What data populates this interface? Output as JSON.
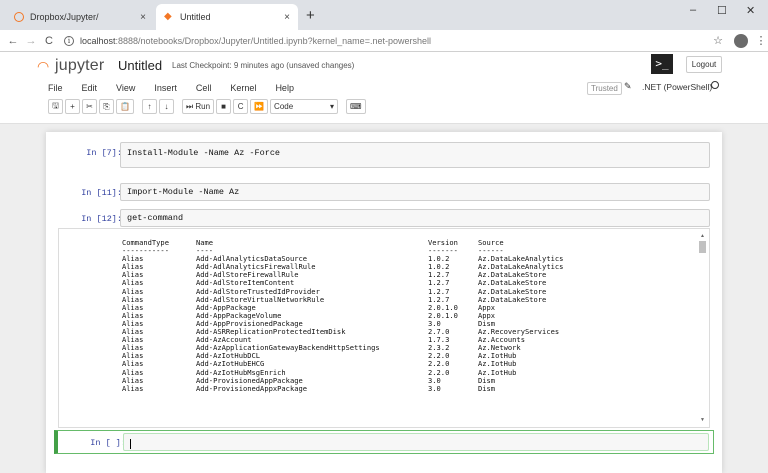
{
  "browser": {
    "tabs": [
      {
        "title": "Dropbox/Jupyter/",
        "close": "×"
      },
      {
        "title": "Untitled",
        "close": "×"
      }
    ],
    "new_tab": "+",
    "window_controls": {
      "minimize": "–",
      "maximize": "☐",
      "close": "✕"
    },
    "nav": {
      "back": "←",
      "forward": "→",
      "reload": "C"
    },
    "url_host": "localhost",
    "url_rest": ":8888/notebooks/Dropbox/Jupyter/Untitled.ipynb?kernel_name=.net-powershell",
    "star": "☆",
    "menu": "⋮"
  },
  "jupyter": {
    "logo_text": "jupyter",
    "notebook_name": "Untitled",
    "checkpoint": "Last Checkpoint: 9 minutes ago  (unsaved changes)",
    "kernel_logo": ">_",
    "logout": "Logout",
    "menu": [
      "File",
      "Edit",
      "View",
      "Insert",
      "Cell",
      "Kernel",
      "Help"
    ],
    "trusted": "Trusted",
    "kernel_name": ".NET (PowerShell)",
    "toolbar": {
      "save": "🖫",
      "add": "+",
      "cut": "✂",
      "copy": "⎘",
      "paste": "📋",
      "up": "↑",
      "down": "↓",
      "run": "⏭ Run",
      "stop": "■",
      "restart": "C",
      "restart_run": "⏩",
      "cell_type": "Code",
      "cell_type_arrow": "▾",
      "keyboard": "⌨"
    }
  },
  "cells": [
    {
      "prompt": "In [7]:",
      "code": "Install-Module -Name Az -Force"
    },
    {
      "prompt": "In [11]:",
      "code": "Import-Module -Name Az"
    },
    {
      "prompt": "In [12]:",
      "code": "get-command"
    },
    {
      "prompt": "In [ ]:",
      "code": ""
    }
  ],
  "output": {
    "header": [
      "CommandType",
      "Name",
      "Version",
      "Source"
    ],
    "underline": [
      "-----------",
      "----",
      "-------",
      "------"
    ],
    "rows": [
      [
        "Alias",
        "Add-AdlAnalyticsDataSource",
        "1.0.2",
        "Az.DataLakeAnalytics"
      ],
      [
        "Alias",
        "Add-AdlAnalyticsFirewallRule",
        "1.0.2",
        "Az.DataLakeAnalytics"
      ],
      [
        "Alias",
        "Add-AdlStoreFirewallRule",
        "1.2.7",
        "Az.DataLakeStore"
      ],
      [
        "Alias",
        "Add-AdlStoreItemContent",
        "1.2.7",
        "Az.DataLakeStore"
      ],
      [
        "Alias",
        "Add-AdlStoreTrustedIdProvider",
        "1.2.7",
        "Az.DataLakeStore"
      ],
      [
        "Alias",
        "Add-AdlStoreVirtualNetworkRule",
        "1.2.7",
        "Az.DataLakeStore"
      ],
      [
        "Alias",
        "Add-AppPackage",
        "2.0.1.0",
        "Appx"
      ],
      [
        "Alias",
        "Add-AppPackageVolume",
        "2.0.1.0",
        "Appx"
      ],
      [
        "Alias",
        "Add-AppProvisionedPackage",
        "3.0",
        "Dism"
      ],
      [
        "Alias",
        "Add-ASRReplicationProtectedItemDisk",
        "2.7.0",
        "Az.RecoveryServices"
      ],
      [
        "Alias",
        "Add-AzAccount",
        "1.7.3",
        "Az.Accounts"
      ],
      [
        "Alias",
        "Add-AzApplicationGatewayBackendHttpSettings",
        "2.3.2",
        "Az.Network"
      ],
      [
        "Alias",
        "Add-AzIotHubDCL",
        "2.2.0",
        "Az.IotHub"
      ],
      [
        "Alias",
        "Add-AzIotHubEHCG",
        "2.2.0",
        "Az.IotHub"
      ],
      [
        "Alias",
        "Add-AzIotHubMsgEnrich",
        "2.2.0",
        "Az.IotHub"
      ],
      [
        "Alias",
        "Add-ProvisionedAppPackage",
        "3.0",
        "Dism"
      ],
      [
        "Alias",
        "Add-ProvisionedAppxPackage",
        "3.0",
        "Dism"
      ]
    ]
  }
}
